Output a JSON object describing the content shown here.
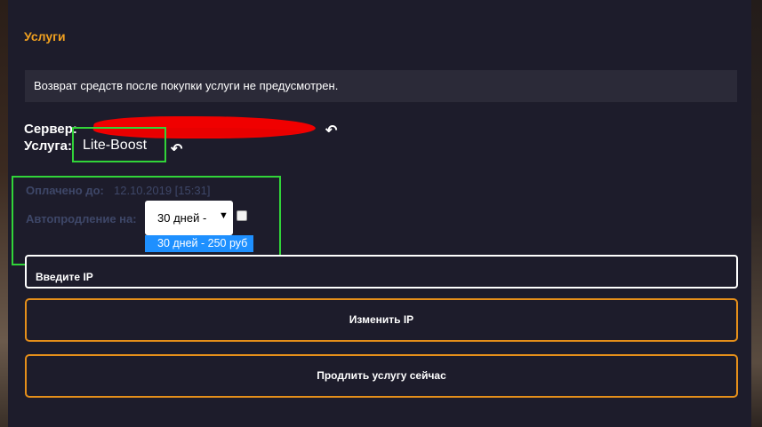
{
  "section_title": "Услуги",
  "notice_text": "Возврат средств после покупки услуги не предусмотрен.",
  "server": {
    "label": "Сервер:",
    "value_redacted": true
  },
  "service": {
    "label": "Услуга:",
    "value": "Lite-Boost"
  },
  "back_icon": "↶",
  "paid_until": {
    "label": "Оплачено до:",
    "value": "12.10.2019 [15:31]"
  },
  "autorenew": {
    "label": "Автопродление на:",
    "selected": "30 дней -",
    "options": [
      "30 дней - 250 руб"
    ],
    "checkbox_checked": false
  },
  "ip_input": {
    "placeholder": "Введите IP"
  },
  "buttons": {
    "change_ip": "Изменить IP",
    "renew_now": "Продлить услугу сейчас"
  },
  "colors": {
    "accent": "#f0a020",
    "highlight": "#31d439",
    "redaction": "#f00000"
  }
}
